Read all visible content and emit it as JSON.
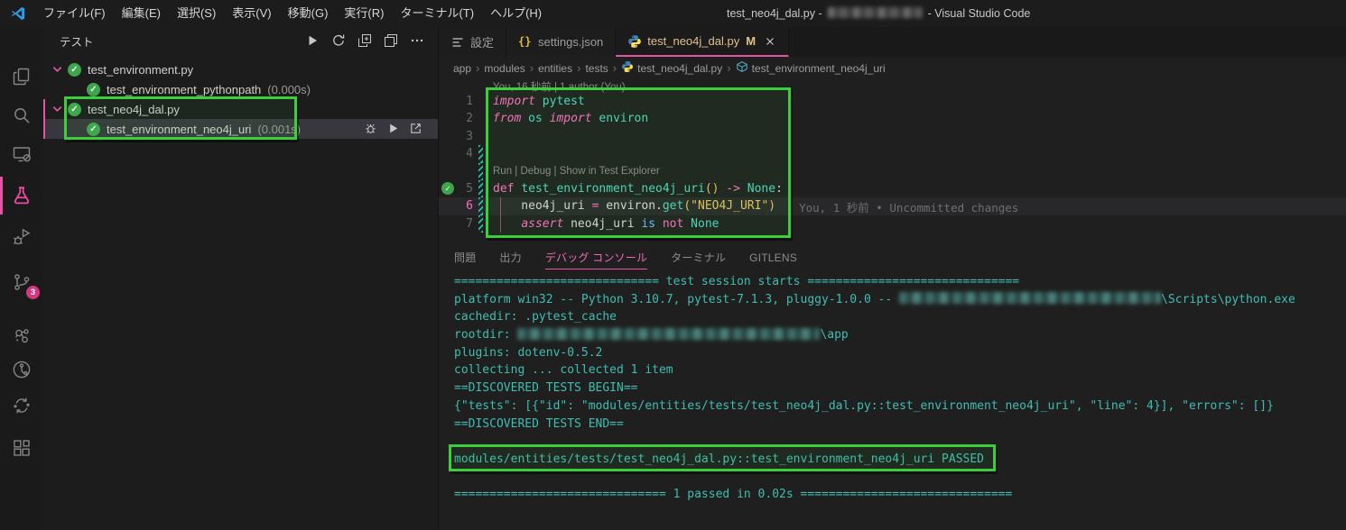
{
  "colors": {
    "accent_pink": "#e255a1",
    "annotation_green": "#3ccf3c",
    "console_teal": "#3fbdb2",
    "pass_green": "#3fa44d",
    "modified_gold": "#e2c08d"
  },
  "title_bar": {
    "menus": [
      "ファイル(F)",
      "編集(E)",
      "選択(S)",
      "表示(V)",
      "移動(G)",
      "実行(R)",
      "ターミナル(T)",
      "ヘルプ(H)"
    ],
    "title_prefix": "test_neo4j_dal.py -",
    "title_suffix": "- Visual Studio Code"
  },
  "activity_bar": {
    "items": [
      {
        "icon": "files",
        "name": "explorer"
      },
      {
        "icon": "search",
        "name": "search"
      },
      {
        "icon": "remote",
        "name": "remote-explorer"
      },
      {
        "icon": "beaker",
        "name": "testing",
        "active": true
      },
      {
        "icon": "rundebug",
        "name": "run-and-debug"
      },
      {
        "icon": "scm",
        "name": "source-control",
        "badge": "3"
      },
      {
        "icon": "graph",
        "name": "graph-extension"
      },
      {
        "icon": "gitlens",
        "name": "gitlens"
      },
      {
        "icon": "sync",
        "name": "compare-sync-extension"
      },
      {
        "icon": "layout",
        "name": "extensions-layout"
      }
    ]
  },
  "sidebar": {
    "title": "テスト",
    "toolbar": [
      {
        "icon": "play",
        "name": "run-tests"
      },
      {
        "icon": "refresh",
        "name": "refresh-tests"
      },
      {
        "icon": "newwin",
        "name": "run-tests-new-window"
      },
      {
        "icon": "collapse",
        "name": "collapse-all"
      },
      {
        "icon": "more",
        "name": "more-actions"
      }
    ],
    "tree": [
      {
        "label": "test_environment.py",
        "level": 0,
        "expanded": true,
        "state": "pass"
      },
      {
        "label": "test_environment_pythonpath",
        "duration": "(0.000s)",
        "level": 1,
        "state": "pass"
      },
      {
        "label": "test_neo4j_dal.py",
        "level": 0,
        "expanded": true,
        "state": "pass"
      },
      {
        "label": "test_environment_neo4j_uri",
        "duration": "(0.001s)",
        "level": 1,
        "state": "pass",
        "selected": true,
        "actions": [
          {
            "icon": "bug",
            "name": "debug-test"
          },
          {
            "icon": "play",
            "name": "run-test"
          },
          {
            "icon": "goto",
            "name": "go-to-test"
          }
        ]
      }
    ]
  },
  "editor": {
    "tabs": [
      {
        "label": "設定",
        "icon": "listicon",
        "name": "tab-settings"
      },
      {
        "label": "settings.json",
        "icon": "braces",
        "name": "tab-settings-json"
      },
      {
        "label": "test_neo4j_dal.py",
        "icon": "python",
        "modified": "M",
        "active": true,
        "closable": true,
        "name": "tab-test-neo4j-dal"
      }
    ],
    "breadcrumb": [
      {
        "label": "app"
      },
      {
        "label": "modules"
      },
      {
        "label": "entities"
      },
      {
        "label": "tests"
      },
      {
        "label": "test_neo4j_dal.py",
        "icon": "python"
      },
      {
        "label": "test_environment_neo4j_uri",
        "icon": "method"
      }
    ],
    "code_rows": [
      {
        "lens": "You, 16 秒前 | 1 author (You)",
        "top": true
      },
      {
        "num": "1",
        "tokens": [
          [
            "kwi",
            "import"
          ],
          [
            "pl",
            " "
          ],
          [
            "ty",
            "pytest"
          ]
        ]
      },
      {
        "num": "2",
        "tokens": [
          [
            "kwi",
            "from"
          ],
          [
            "pl",
            " "
          ],
          [
            "ty",
            "os"
          ],
          [
            "pl",
            " "
          ],
          [
            "kwi",
            "import"
          ],
          [
            "pl",
            " "
          ],
          [
            "ty",
            "environ"
          ]
        ]
      },
      {
        "num": "3",
        "tokens": []
      },
      {
        "num": "4",
        "tokens": [],
        "modified": true
      },
      {
        "lens": "Run | Debug | Show in Test Explorer",
        "modified": true
      },
      {
        "num": "5",
        "tokens": [
          [
            "kw",
            "def"
          ],
          [
            "pl",
            " "
          ],
          [
            "fn",
            "test_environment_neo4j_uri"
          ],
          [
            "br",
            "()"
          ],
          [
            "pl",
            " "
          ],
          [
            "kw",
            "->"
          ],
          [
            "pl",
            " "
          ],
          [
            "ty",
            "None"
          ],
          [
            "pl",
            ":"
          ]
        ],
        "modified": true,
        "pass": true
      },
      {
        "num": "6",
        "tokens": [
          [
            "pl",
            "    neo4j_uri "
          ],
          [
            "kw",
            "="
          ],
          [
            "pl",
            " environ."
          ],
          [
            "ty",
            "get"
          ],
          [
            "br",
            "("
          ],
          [
            "str",
            "\"NEO4J_URI\""
          ],
          [
            "br",
            ")"
          ]
        ],
        "modified": true,
        "current": true,
        "guide": true,
        "blame": "You, 1 秒前 • Uncommitted changes"
      },
      {
        "num": "7",
        "tokens": [
          [
            "pl",
            "    "
          ],
          [
            "kwi",
            "assert"
          ],
          [
            "pl",
            " neo4j_uri "
          ],
          [
            "kwb",
            "is"
          ],
          [
            "pl",
            " "
          ],
          [
            "kw",
            "not"
          ],
          [
            "pl",
            " "
          ],
          [
            "ty",
            "None"
          ]
        ],
        "modified": true,
        "guide": true
      }
    ]
  },
  "panel": {
    "tabs": [
      {
        "label": "問題",
        "name": "problems"
      },
      {
        "label": "出力",
        "name": "output"
      },
      {
        "label": "デバッグ コンソール",
        "name": "debug-console",
        "active": true
      },
      {
        "label": "ターミナル",
        "name": "terminal"
      },
      {
        "label": "GITLENS",
        "name": "gitlens-panel"
      }
    ],
    "console": [
      {
        "s": [
          {
            "t": "============================= test session starts =============================="
          }
        ]
      },
      {
        "s": [
          {
            "t": "platform win32 -- Python 3.10.7, pytest-7.1.3, pluggy-1.0.0 -- "
          },
          {
            "b": 290
          },
          {
            "t": "\\Scripts\\python.exe"
          }
        ]
      },
      {
        "s": [
          {
            "t": "cachedir: .pytest_cache"
          }
        ]
      },
      {
        "s": [
          {
            "t": "rootdir: "
          },
          {
            "b": 335
          },
          {
            "t": "\\app"
          }
        ]
      },
      {
        "s": [
          {
            "t": "plugins: dotenv-0.5.2"
          }
        ]
      },
      {
        "s": [
          {
            "t": "collecting ... collected 1 item"
          }
        ]
      },
      {
        "s": [
          {
            "t": "==DISCOVERED TESTS BEGIN=="
          }
        ]
      },
      {
        "s": [
          {
            "t": "{\"tests\": [{\"id\": \"modules/entities/tests/test_neo4j_dal.py::test_environment_neo4j_uri\", \"line\": 4}], \"errors\": []}"
          }
        ]
      },
      {
        "s": [
          {
            "t": "==DISCOVERED TESTS END=="
          }
        ]
      },
      {
        "s": []
      },
      {
        "s": [
          {
            "t": "modules/entities/tests/test_neo4j_dal.py::test_environment_neo4j_uri PASSED"
          }
        ],
        "annotated": true
      },
      {
        "s": []
      },
      {
        "s": [
          {
            "t": "============================== 1 passed in 0.02s =============================="
          }
        ]
      }
    ]
  }
}
